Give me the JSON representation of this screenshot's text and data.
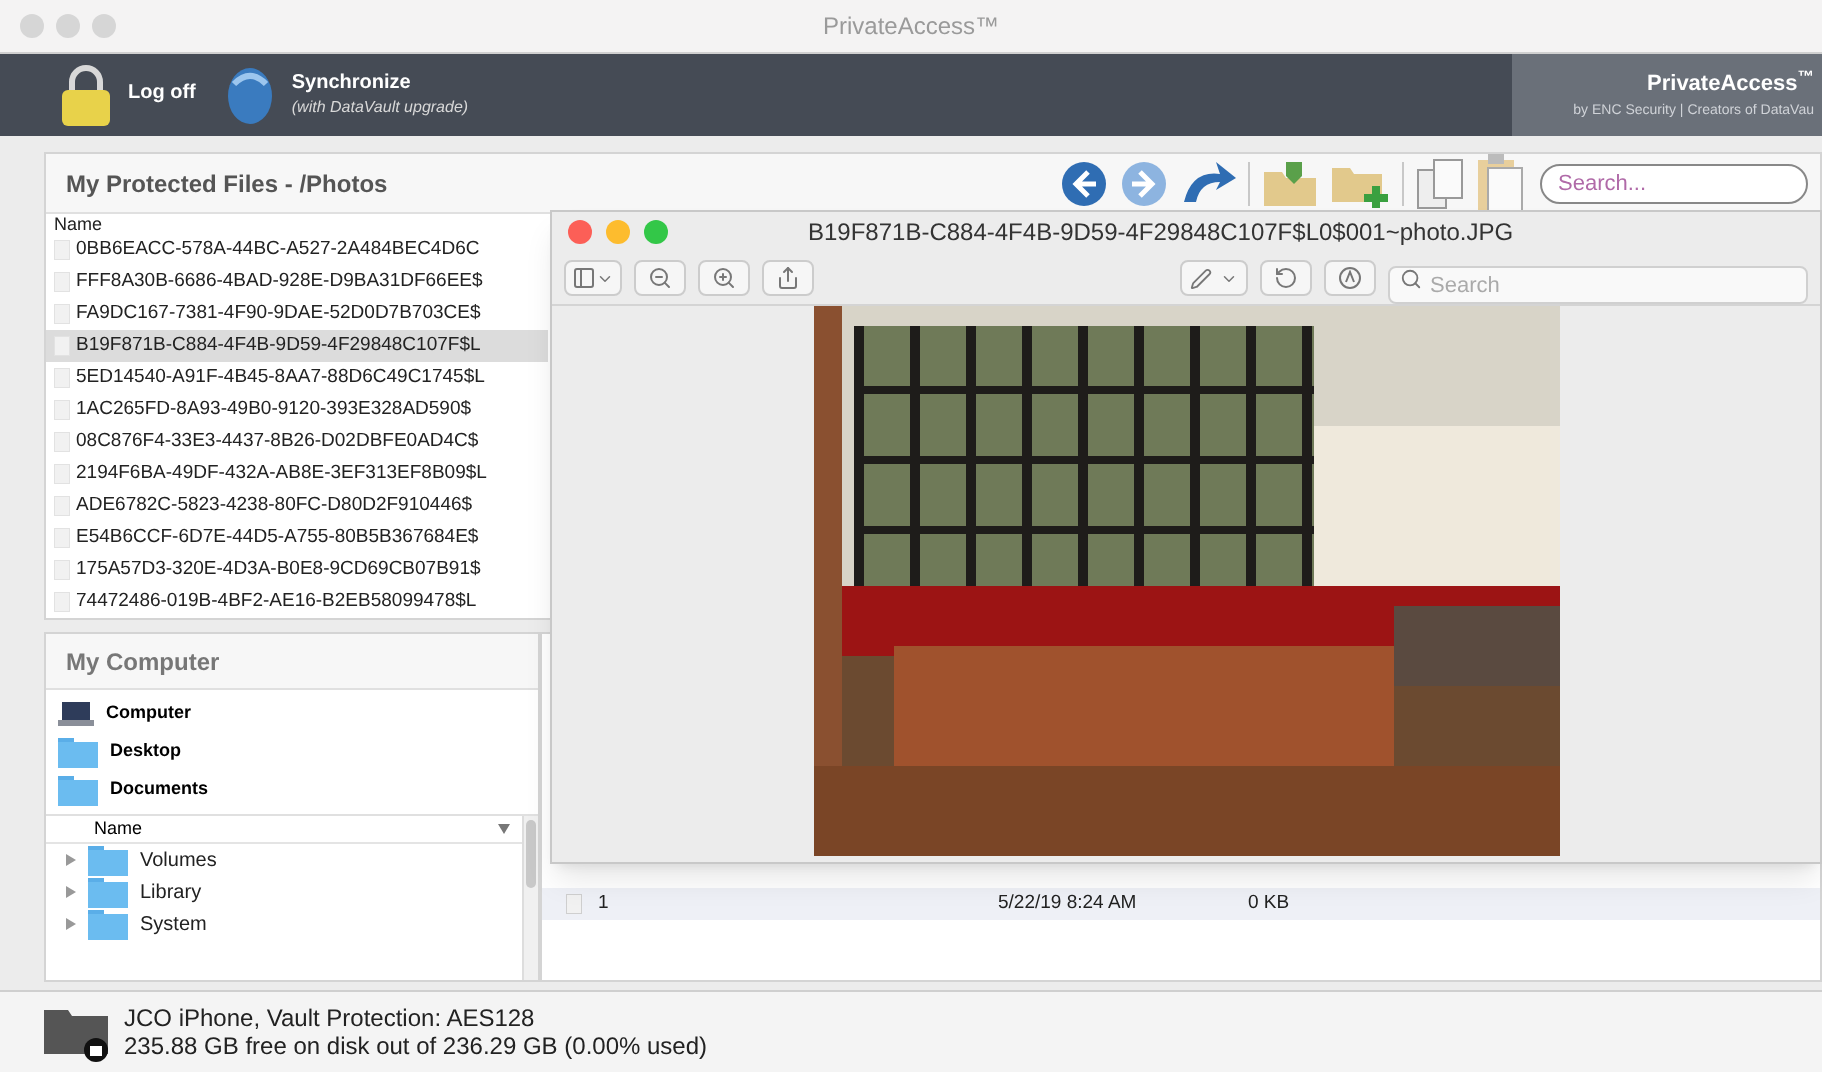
{
  "app_title": "PrivateAccess™",
  "toolbar": {
    "buttons": [
      {
        "label": "Log off",
        "kind": "lock"
      },
      {
        "label": "Synchronize",
        "sublabel": "(with DataVault upgrade)",
        "kind": "sync"
      }
    ],
    "brand": "PrivateAccess$^{™}$",
    "brand_tagline": "by ENC Security | Creators of DataVau"
  },
  "protected_files": {
    "title": "My Protected Files - /Photos",
    "search": {
      "placeholder": "Search..."
    },
    "column": "Name",
    "rows": [
      {
        "name": "0BB6EACC-578A-44BC-A527-2A484BEC4D6C",
        "selected": false
      },
      {
        "name": "FFF8A30B-6686-4BAD-928E-D9BA31DF66EE$",
        "selected": false
      },
      {
        "name": "FA9DC167-7381-4F90-9DAE-52D0D7B703CE$",
        "selected": false
      },
      {
        "name": "B19F871B-C884-4F4B-9D59-4F29848C107F$L",
        "selected": true
      },
      {
        "name": "5ED14540-A91F-4B45-8AA7-88D6C49C1745$L",
        "selected": false
      },
      {
        "name": "1AC265FD-8A93-49B0-9120-393E328AD590$",
        "selected": false
      },
      {
        "name": "08C876F4-33E3-4437-8B26-D02DBFE0AD4C$",
        "selected": false
      },
      {
        "name": "2194F6BA-49DF-432A-AB8E-3EF313EF8B09$L",
        "selected": false
      },
      {
        "name": "ADE6782C-5823-4238-80FC-D80D2F910446$",
        "selected": false
      },
      {
        "name": "E54B6CCF-6D7E-44D5-A755-80B5B367684E$",
        "selected": false
      },
      {
        "name": "175A57D3-320E-4D3A-B0E8-9CD69CB07B91$",
        "selected": false
      },
      {
        "name": "74472486-019B-4BF2-AE16-B2EB58099478$L",
        "selected": false
      }
    ]
  },
  "my_computer": {
    "title": "My Computer",
    "places": [
      {
        "label": "Computer",
        "kind": "computer"
      },
      {
        "label": "Desktop",
        "kind": "folder"
      },
      {
        "label": "Documents",
        "kind": "folder"
      }
    ],
    "column": "Name",
    "tree": [
      {
        "name": "Volumes",
        "expanded": false
      },
      {
        "name": "Library",
        "expanded": false
      },
      {
        "name": "System",
        "expanded": false
      }
    ]
  },
  "file_table": {
    "rows": [
      {
        "name": "1",
        "date": "5/22/19 8:24 AM",
        "size": "0 KB"
      }
    ]
  },
  "preview": {
    "title": "B19F871B-C884-4F4B-9D59-4F29848C107F$L0$001~photo.JPG",
    "search": {
      "placeholder": "Search"
    }
  },
  "status_bar": {
    "line_1": "JCO iPhone, Vault Protection: AES128",
    "line_2": "235.88 GB free on disk out of 236.29 GB (0.00% used)"
  }
}
